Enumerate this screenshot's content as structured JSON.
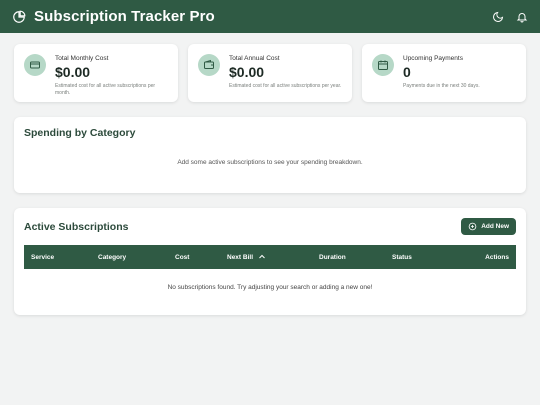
{
  "app": {
    "title": "Subscription Tracker Pro",
    "theme_color": "#2f5a44"
  },
  "header_icons": [
    "pie-chart-logo-icon",
    "moon-icon",
    "bell-icon"
  ],
  "stats": [
    {
      "label": "Total Monthly Cost",
      "value": "$0.00",
      "description": "Estimated cost for all active subscriptions per month.",
      "icon": "credit-card-icon"
    },
    {
      "label": "Total Annual Cost",
      "value": "$0.00",
      "description": "Estimated cost for all active subscriptions per year.",
      "icon": "wallet-icon"
    },
    {
      "label": "Upcoming Payments",
      "value": "0",
      "description": "Payments due in the next 30 days.",
      "icon": "calendar-icon"
    }
  ],
  "category": {
    "title": "Spending by Category",
    "empty_message": "Add some active subscriptions to see your spending breakdown."
  },
  "subscriptions": {
    "title": "Active Subscriptions",
    "add_label": "Add New",
    "columns": [
      "Service",
      "Category",
      "Cost",
      "Next Bill",
      "Duration",
      "Status",
      "Actions"
    ],
    "sorted_column": "Next Bill",
    "sort_direction": "ascending",
    "empty_message": "No subscriptions found. Try adjusting your search or adding a new one!"
  }
}
